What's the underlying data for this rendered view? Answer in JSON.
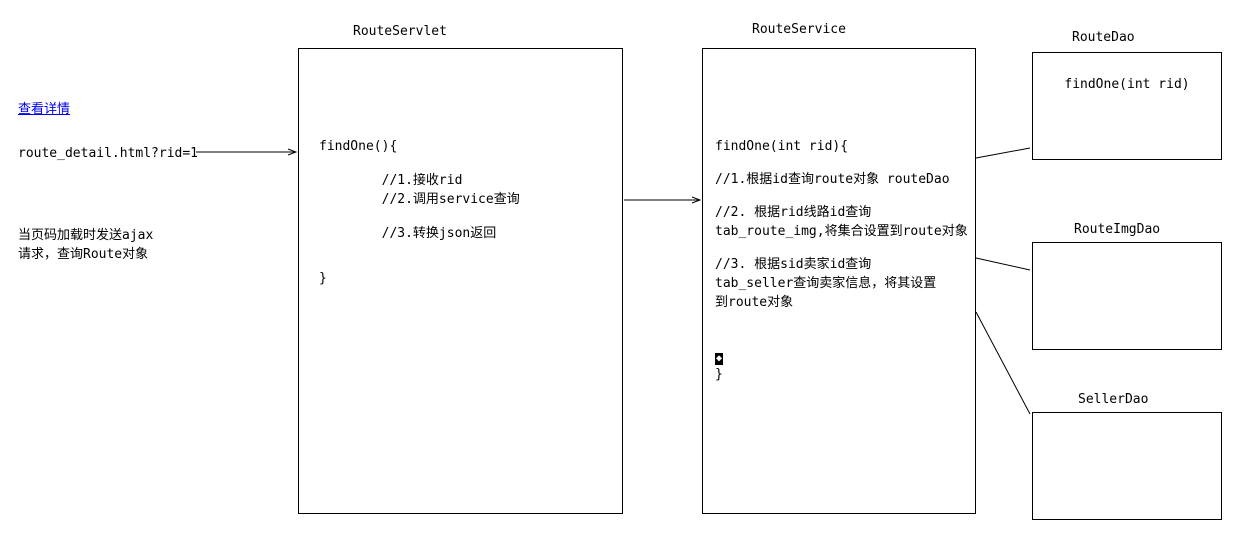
{
  "left": {
    "link_label": "查看详情",
    "url_text": "route_detail.html?rid=1",
    "note": "当页码加载时发送ajax\n请求，查询Route对象"
  },
  "servlet": {
    "title": "RouteServlet",
    "code": "findOne(){\n\n        //1.接收rid\n        //2.调用service查询\n\n        //3.转换json返回\n\n\n}"
  },
  "service": {
    "title": "RouteService",
    "code_line1": "findOne(int rid){",
    "code_line2": "//1.根据id查询route对象 routeDao",
    "code_line3": "//2. 根据rid线路id查询\ntab_route_img,将集合设置到route对象",
    "code_line4": "//3. 根据sid卖家id查询\ntab_seller查询卖家信息，将其设置\n到route对象",
    "code_caret": "◆",
    "code_brace": "}"
  },
  "routeDao": {
    "title": "RouteDao",
    "method": "findOne(int rid)"
  },
  "routeImgDao": {
    "title": "RouteImgDao"
  },
  "sellerDao": {
    "title": "SellerDao"
  }
}
